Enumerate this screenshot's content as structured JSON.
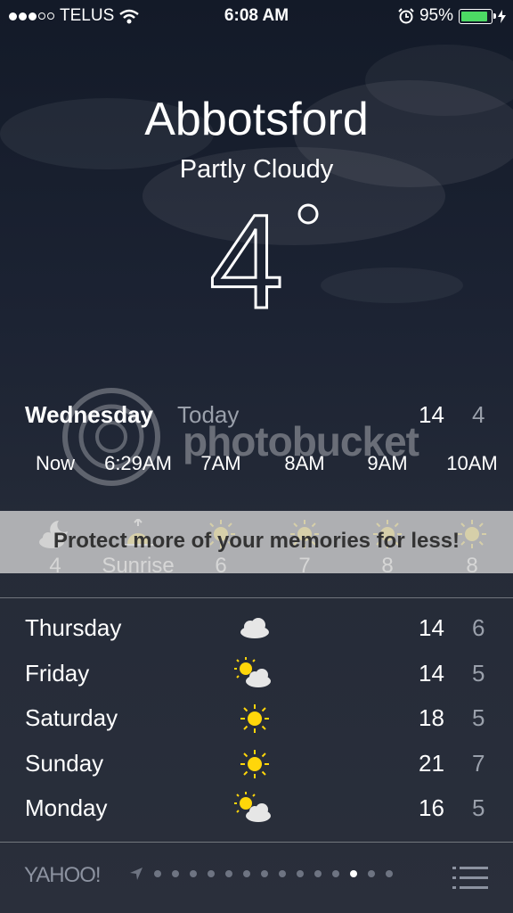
{
  "status_bar": {
    "carrier": "TELUS",
    "time": "6:08 AM",
    "battery_percent": "95%",
    "battery_level": 0.95,
    "signal_bars": 3,
    "signal_total": 5
  },
  "location": {
    "city": "Abbotsford",
    "condition": "Partly Cloudy",
    "temperature": "4"
  },
  "today": {
    "day": "Wednesday",
    "label": "Today",
    "high": "14",
    "low": "4"
  },
  "hourly": [
    {
      "time": "Now",
      "icon": "partly-cloudy-night-icon",
      "value": "4"
    },
    {
      "time": "6:29AM",
      "icon": "sunrise-icon",
      "value": "Sunrise"
    },
    {
      "time": "7AM",
      "icon": "sun-icon",
      "value": "6"
    },
    {
      "time": "8AM",
      "icon": "sun-icon",
      "value": "7"
    },
    {
      "time": "9AM",
      "icon": "sun-icon",
      "value": "8"
    },
    {
      "time": "10AM",
      "icon": "sun-icon",
      "value": "8"
    }
  ],
  "overlay": {
    "banner_text": "Protect more of your memories for less!",
    "watermark_text": "photobucket"
  },
  "daily": [
    {
      "day": "Thursday",
      "icon": "cloud-icon",
      "high": "14",
      "low": "6"
    },
    {
      "day": "Friday",
      "icon": "partly-cloudy-icon",
      "high": "14",
      "low": "5"
    },
    {
      "day": "Saturday",
      "icon": "sun-icon",
      "high": "18",
      "low": "5"
    },
    {
      "day": "Sunday",
      "icon": "sun-icon",
      "high": "21",
      "low": "7"
    },
    {
      "day": "Monday",
      "icon": "partly-cloudy-icon",
      "high": "16",
      "low": "5"
    }
  ],
  "footer": {
    "brand": "YAHOO!",
    "page_count": 14,
    "active_page": 11
  },
  "colors": {
    "battery": "#4cd964",
    "sun": "#ffd60a",
    "cloud": "#e6e6e6",
    "muted_text": "#9aa0ab"
  }
}
